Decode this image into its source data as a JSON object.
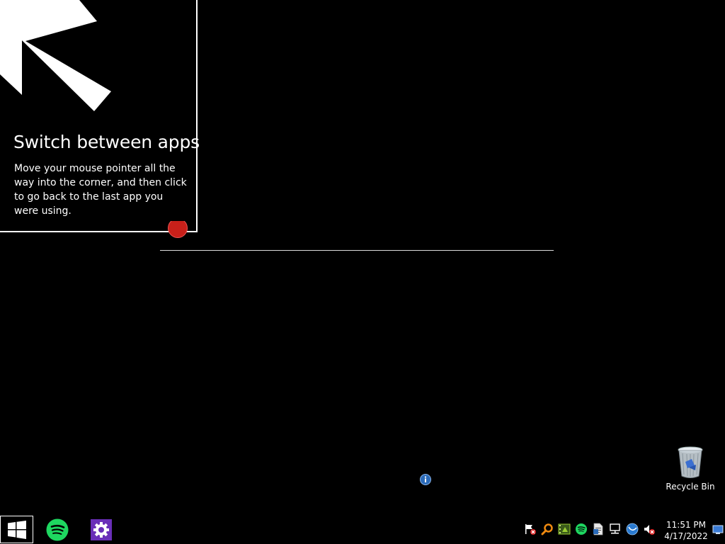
{
  "tip": {
    "title": "Switch between apps",
    "body": "Move your mouse pointer all the way into the corner, and then click to go back to the last app you were using."
  },
  "desktop": {
    "recycle_bin_label": "Recycle Bin"
  },
  "taskbar": {
    "clock_time": "11:51 PM",
    "clock_date": "4/17/2022",
    "pinned": [
      "windows-start-icon",
      "spotify-icon",
      "settings-gear-icon"
    ],
    "tray_icons": [
      "action-center-flag-icon",
      "search-magnifier-icon",
      "film-icon",
      "spotify-icon",
      "document-icon",
      "network-icon",
      "blue-globe-icon",
      "volume-muted-icon"
    ]
  },
  "colors": {
    "background": "#000000",
    "spotify_green": "#1ed760",
    "settings_purple": "#6a2fb8",
    "accent_red": "#c8201a"
  }
}
